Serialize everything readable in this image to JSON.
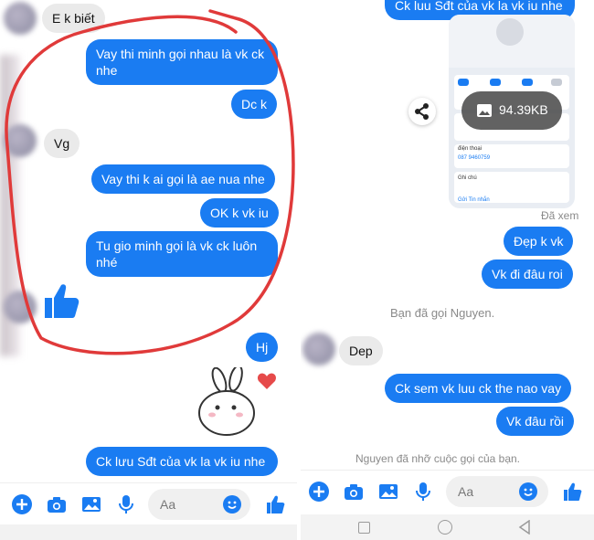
{
  "left": {
    "messages": [
      {
        "dir": "in",
        "text": "E k biết"
      },
      {
        "dir": "out",
        "text": "Vay thi minh gọi nhau là vk ck nhe"
      },
      {
        "dir": "out",
        "text": "Dc k"
      },
      {
        "dir": "in",
        "text": "Vg"
      },
      {
        "dir": "out",
        "text": "Vay thi k ai gọi là ae nua nhe"
      },
      {
        "dir": "out",
        "text": "OK k vk iu"
      },
      {
        "dir": "out",
        "text": "Tu gio minh gọi là vk ck luôn nhé"
      },
      {
        "dir": "out",
        "text": "Hj"
      },
      {
        "dir": "out",
        "text": "Ck lưu Sđt của vk la vk iu nhe"
      }
    ],
    "input_placeholder": "Aa"
  },
  "right": {
    "top_message": "Ck luu Sđt của vk la vk iu nhe",
    "image_size": "94.39KB",
    "seen": "Đã xem",
    "messages": [
      {
        "dir": "out",
        "text": "Đẹp k vk"
      },
      {
        "dir": "out",
        "text": "Vk đi đâu roi"
      },
      {
        "dir": "in",
        "text": "Dep"
      },
      {
        "dir": "out",
        "text": "Ck sem vk luu ck the nao vay"
      },
      {
        "dir": "out",
        "text": "Vk đâu rồi"
      }
    ],
    "call_notice": "Bạn đã gọi Nguyen.",
    "callback_notice": "Nguyen đã nhỡ cuộc gọi của bạn.",
    "contact_card": {
      "phone_label": "điện thoại",
      "phone_value": "087 9460759",
      "note_label": "Ghi chú",
      "send_message": "Gửi Tin nhắn"
    },
    "input_placeholder": "Aa"
  },
  "colors": {
    "accent": "#1a7cf2",
    "annotation": "#e03a3a"
  }
}
